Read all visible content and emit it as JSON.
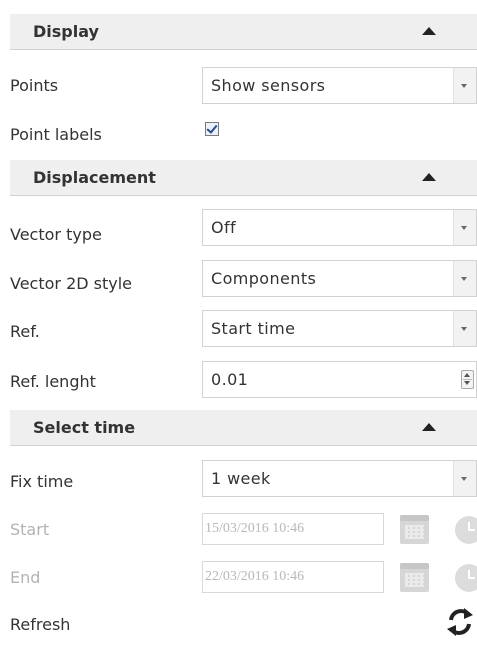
{
  "display": {
    "header": "Display",
    "points_label": "Points",
    "points_value": "Show sensors",
    "point_labels_label": "Point labels",
    "point_labels_checked": true
  },
  "displacement": {
    "header": "Displacement",
    "vector_type_label": "Vector type",
    "vector_type_value": "Off",
    "vector_2d_style_label": "Vector 2D style",
    "vector_2d_style_value": "Components",
    "ref_label": "Ref.",
    "ref_value": "Start time",
    "ref_length_label": "Ref. lenght",
    "ref_length_value": "0.01"
  },
  "select_time": {
    "header": "Select time",
    "fix_time_label": "Fix time",
    "fix_time_value": "1 week",
    "start_label": "Start",
    "start_value": "15/03/2016 10:46",
    "end_label": "End",
    "end_value": "22/03/2016 10:46",
    "refresh_label": "Refresh"
  },
  "icons": {
    "collapse": "chevron-up-icon",
    "dropdown": "chevron-down-icon",
    "calendar": "calendar-icon",
    "clock": "clock-icon",
    "refresh": "refresh-icon"
  },
  "colors": {
    "header_bg": "#efefef",
    "border": "#d2d2d2",
    "disabled_text": "#b3b3b3"
  }
}
